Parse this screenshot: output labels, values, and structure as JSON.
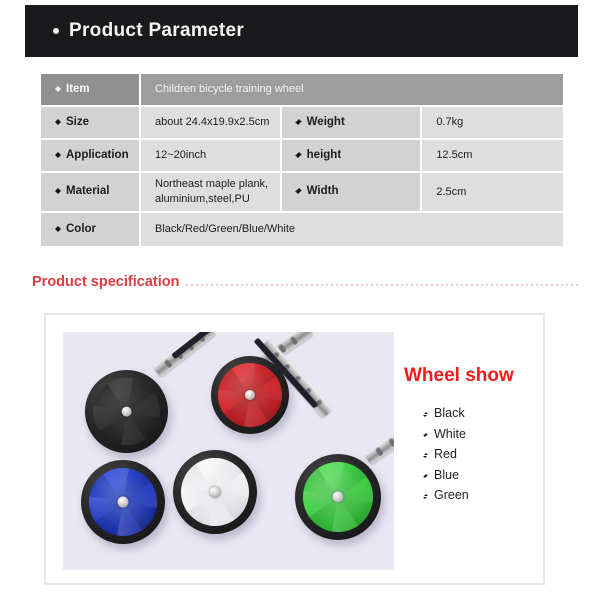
{
  "header": {
    "title": "Product Parameter",
    "bullet_icon": "dot-bullet-icon"
  },
  "parameter_table": {
    "rows": [
      {
        "label": "Item",
        "value": "Children bicycle training wheel",
        "label2": "",
        "value2": "",
        "highlighted": true
      },
      {
        "label": "Size",
        "value": "about 24.4x19.9x2.5cm",
        "label2": "Weight",
        "value2": "0.7kg",
        "highlighted": false
      },
      {
        "label": "Application",
        "value": "12~20inch",
        "label2": "height",
        "value2": "12.5cm",
        "highlighted": false
      },
      {
        "label": "Material",
        "value": "Northeast maple plank,\naluminium,steel,PU",
        "label2": "Width",
        "value2": "2.5cm",
        "highlighted": false
      },
      {
        "label": "Color",
        "value": "Black/Red/Green/Blue/White",
        "label2": "",
        "value2": "",
        "highlighted": false
      }
    ]
  },
  "specification_section": {
    "heading": "Product specification",
    "heading_color": "#e03a3f"
  },
  "wheel_show": {
    "title": "Wheel show",
    "title_color": "#ee1c1c",
    "colors": [
      "Black",
      "White",
      "Red",
      "Blue",
      "Green"
    ]
  },
  "photo": {
    "background_color": "#e9e7f2",
    "wheels": [
      {
        "name": "black-training-wheel",
        "color": "#2b2b2b"
      },
      {
        "name": "red-training-wheel",
        "color": "#d81f26"
      },
      {
        "name": "blue-training-wheel",
        "color": "#1b34c8"
      },
      {
        "name": "white-training-wheel",
        "color": "#f4f4f6"
      },
      {
        "name": "green-training-wheel",
        "color": "#35d13a"
      }
    ]
  }
}
